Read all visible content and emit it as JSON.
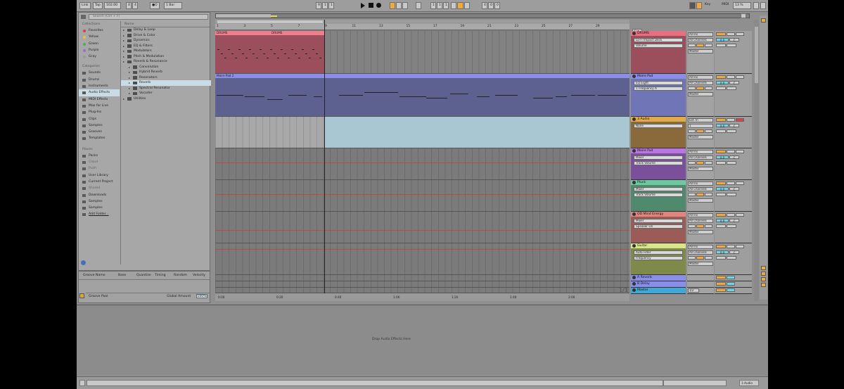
{
  "transport": {
    "link": "Link",
    "tap": "Tap",
    "tempo": "102.00",
    "sig_num": "4",
    "sig_den": "4",
    "metro": "●O",
    "quant": "1 Bar",
    "pos1": "9",
    "pos2": "1",
    "pos3": "1",
    "loop_start1": "1",
    "loop_start2": "1",
    "loop_start3": "1",
    "loop_len1": "4",
    "loop_len2": "0",
    "loop_len3": "0",
    "key": "Key",
    "midi": "MIDI",
    "cpu": "13 %"
  },
  "browser": {
    "search_placeholder": "Search (Ctrl + F)",
    "collections_header": "Collections",
    "collections": [
      {
        "label": "Favorites",
        "color": "#e04040"
      },
      {
        "label": "Yellow",
        "color": "#e8c23a"
      },
      {
        "label": "Green",
        "color": "#4cb050"
      },
      {
        "label": "Purple",
        "color": "#9c6cc8"
      },
      {
        "label": "Gray",
        "color": "#9a9a9a"
      }
    ],
    "categories_header": "Categories",
    "categories": [
      "Sounds",
      "Drums",
      "Instruments",
      "Audio Effects",
      "MIDI Effects",
      "Max for Live",
      "Plug-Ins",
      "Clips",
      "Samples",
      "Grooves",
      "Templates"
    ],
    "places_header": "Places",
    "places": [
      "Packs",
      "Cloud",
      "Push",
      "User Library",
      "Current Project",
      "Shared",
      "Downloads",
      "Samples",
      "Samples",
      "Add Folder..."
    ],
    "name_header": "Name",
    "items": [
      {
        "label": "Delay & Loop",
        "indent": 0
      },
      {
        "label": "Drive & Color",
        "indent": 0
      },
      {
        "label": "Dynamics",
        "indent": 0
      },
      {
        "label": "EQ & Filters",
        "indent": 0
      },
      {
        "label": "Modulators",
        "indent": 0
      },
      {
        "label": "Pitch & Modulation",
        "indent": 0
      },
      {
        "label": "Reverb & Resonance",
        "indent": 0
      },
      {
        "label": "Convolution",
        "indent": 1
      },
      {
        "label": "Hybrid Reverb",
        "indent": 1
      },
      {
        "label": "Resonators",
        "indent": 1
      },
      {
        "label": "Reverb",
        "indent": 1
      },
      {
        "label": "Spectral Resonator",
        "indent": 1
      },
      {
        "label": "Vocoder",
        "indent": 1
      },
      {
        "label": "Utilities",
        "indent": 0
      }
    ]
  },
  "groove": {
    "col_name": "Groove Name",
    "col_base": "Base",
    "col_quant": "Quantize",
    "col_timing": "Timing",
    "col_random": "Random",
    "col_velocity": "Velocity",
    "pool": "Groove Pool",
    "global_label": "Global Amount",
    "global_value": "100%"
  },
  "ruler": [
    "1",
    "3",
    "5",
    "7",
    "9",
    "11",
    "13",
    "15",
    "17",
    "19",
    "21",
    "23",
    "25",
    "27",
    "29"
  ],
  "timeline": [
    "0:00",
    "0:20",
    "0:40",
    "1:00",
    "1:20",
    "1:40",
    "2:00"
  ],
  "clips": {
    "drums1": "DRUMS",
    "drums2": "DRUMS",
    "keys": "Moire Pad 2"
  },
  "tracks": [
    {
      "name": "DRUMS",
      "color": "#e8707e",
      "dd1": "Lo-Fi Impact Deck",
      "dd2": "Volume",
      "in": "All Ins",
      "ch": "All Channels",
      "out": "Master",
      "vol": "0.0",
      "pan": "C"
    },
    {
      "name": "Moire Pad",
      "color": "#8a8ee8",
      "dd1": "EQ Eight",
      "dd2": "1 Frequency A",
      "in": "All Ins",
      "ch": "All Channels",
      "out": "Master",
      "vol": "0.0",
      "pan": "C"
    },
    {
      "name": "3 Audio",
      "color": "#e0a94a",
      "dd1": "None",
      "dd2": "",
      "in": "Ext. In",
      "ch": "1",
      "out": "Master",
      "vol": "0.0",
      "pan": "C"
    },
    {
      "name": "Moire Pad",
      "color": "#b877e0",
      "dd1": "Mixer",
      "dd2": "Track Volume",
      "in": "All Ins",
      "ch": "All Channels",
      "out": "Master",
      "vol": "0.0",
      "pan": "C"
    },
    {
      "name": "Pluck",
      "color": "#6fc9a0",
      "dd1": "Mixer",
      "dd2": "Track Volume",
      "in": "All Ins",
      "ch": "All Channels",
      "out": "Master",
      "vol": "0.0",
      "pan": "C"
    },
    {
      "name": "OD Mind Energy",
      "color": "#e0867e",
      "dd1": "Mixer",
      "dd2": "Speaker On",
      "in": "All Ins",
      "ch": "All Channels",
      "out": "Master",
      "vol": "0.0",
      "pan": "C"
    },
    {
      "name": "Guitar",
      "color": "#d8e58a",
      "dd1": "Auto Filter",
      "dd2": "Frequency",
      "in": "All Ins",
      "ch": "All Channels",
      "out": "Master",
      "vol": "0.0",
      "pan": "C"
    }
  ],
  "returns": [
    {
      "name": "A Reverb",
      "color": "#8a8ee8"
    },
    {
      "name": "B Delay",
      "color": "#8a8ee8"
    },
    {
      "name": "Master",
      "color": "#3fa8d8"
    }
  ],
  "master_io": "1/2",
  "master_count": "1/1",
  "detail_drop": "Drop Audio Effects Here",
  "status_right": "1-Audio",
  "colors": {
    "orange": "#f1a93b",
    "cyan": "#6fd6e8",
    "selected": "#c9dce6"
  }
}
